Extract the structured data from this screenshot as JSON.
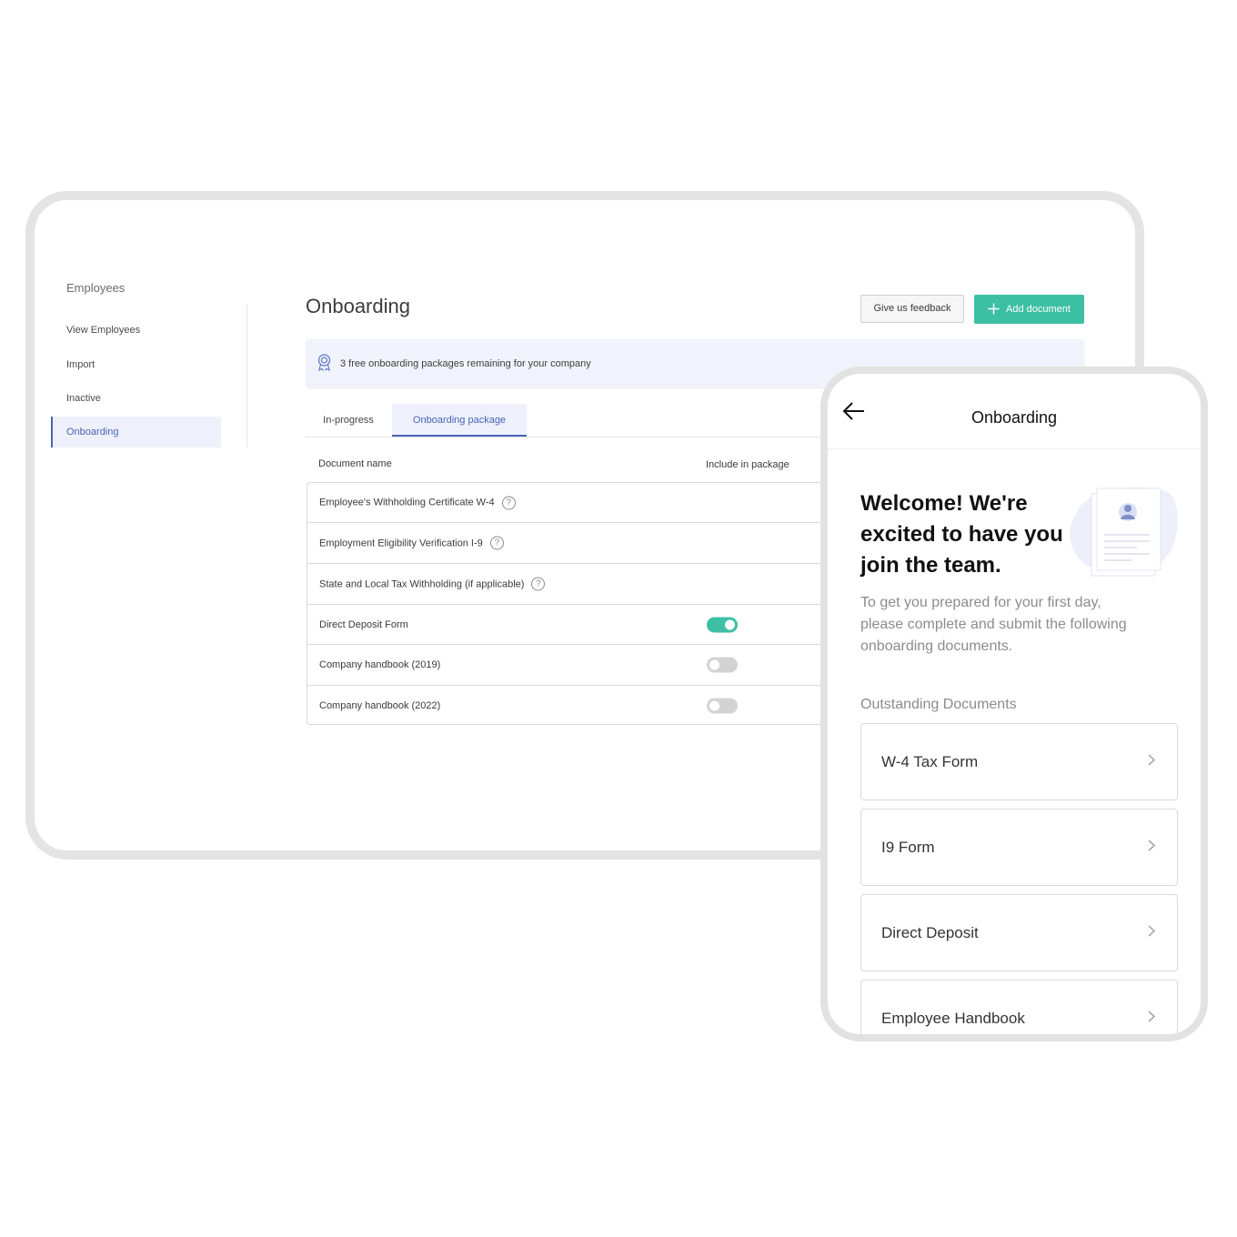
{
  "sidebar": {
    "title": "Employees",
    "items": [
      {
        "label": "View Employees"
      },
      {
        "label": "Import"
      },
      {
        "label": "Inactive"
      },
      {
        "label": "Onboarding",
        "active": true
      }
    ]
  },
  "main": {
    "title": "Onboarding",
    "feedback_label": "Give us feedback",
    "add_label": "Add document",
    "banner_text": "3 free onboarding packages remaining for your company",
    "tabs": [
      {
        "label": "In-progress"
      },
      {
        "label": "Onboarding package",
        "active": true
      }
    ],
    "columns": {
      "name": "Document name",
      "include": "Include in package"
    },
    "documents": [
      {
        "name": "Employee's Withholding Certificate W-4",
        "help": true
      },
      {
        "name": "Employment Eligibility Verification I-9",
        "help": true
      },
      {
        "name": "State and Local Tax Withholding (if applicable)",
        "help": true
      },
      {
        "name": "Direct Deposit Form",
        "included": true
      },
      {
        "name": "Company handbook (2019)",
        "included": false
      },
      {
        "name": "Company handbook (2022)",
        "included": false
      }
    ]
  },
  "mobile": {
    "title": "Onboarding",
    "welcome": "Welcome! We're excited to have you join the team.",
    "intro": "To get you prepared for your first day, please complete and submit the following onboarding documents.",
    "outstanding_label": "Outstanding Documents",
    "documents": [
      {
        "label": "W-4 Tax Form"
      },
      {
        "label": "I9 Form"
      },
      {
        "label": "Direct Deposit"
      },
      {
        "label": "Employee Handbook"
      }
    ]
  },
  "colors": {
    "accent": "#3dbfa4",
    "brand_blue": "#4a63b8",
    "banner_bg": "#f0f3fb"
  },
  "icons": [
    "plus-icon",
    "award-icon",
    "help-icon",
    "back-arrow-icon",
    "chevron-right-icon",
    "document-illustration"
  ]
}
